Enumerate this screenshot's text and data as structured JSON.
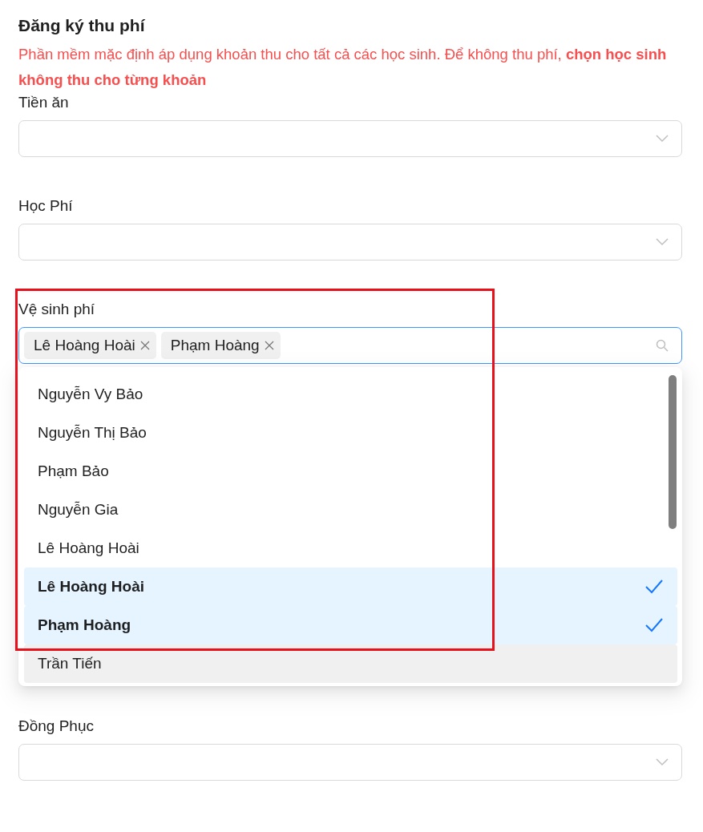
{
  "title": "Đăng ký thu phí",
  "notice": "Phần mềm mặc định áp dụng khoản thu cho tất cả các học sinh. Để không thu phí, **chọn học sinh không thu cho từng khoản**",
  "fields": [
    {
      "kind": "select",
      "label": "Tiền ăn"
    },
    {
      "kind": "select",
      "label": "Học Phí"
    },
    {
      "kind": "multiselect",
      "label": "Vệ sinh phí",
      "tags": [
        "Lê Hoàng Hoài",
        "Phạm Hoàng"
      ],
      "options": [
        {
          "label": "Nguyễn Vy Bảo",
          "selected": false,
          "hovered": false
        },
        {
          "label": "Nguyễn Thị Bảo",
          "selected": false,
          "hovered": false
        },
        {
          "label": "Phạm Bảo",
          "selected": false,
          "hovered": false
        },
        {
          "label": "Nguyễn Gia",
          "selected": false,
          "hovered": false
        },
        {
          "label": "Lê Hoàng Hoài",
          "selected": false,
          "hovered": false
        },
        {
          "label": "Lê Hoàng Hoài",
          "selected": true,
          "hovered": false
        },
        {
          "label": "Phạm Hoàng",
          "selected": true,
          "hovered": false
        },
        {
          "label": "Trần Tiến",
          "selected": false,
          "hovered": true
        }
      ]
    },
    {
      "kind": "select",
      "label": "Đồng Phục"
    }
  ]
}
